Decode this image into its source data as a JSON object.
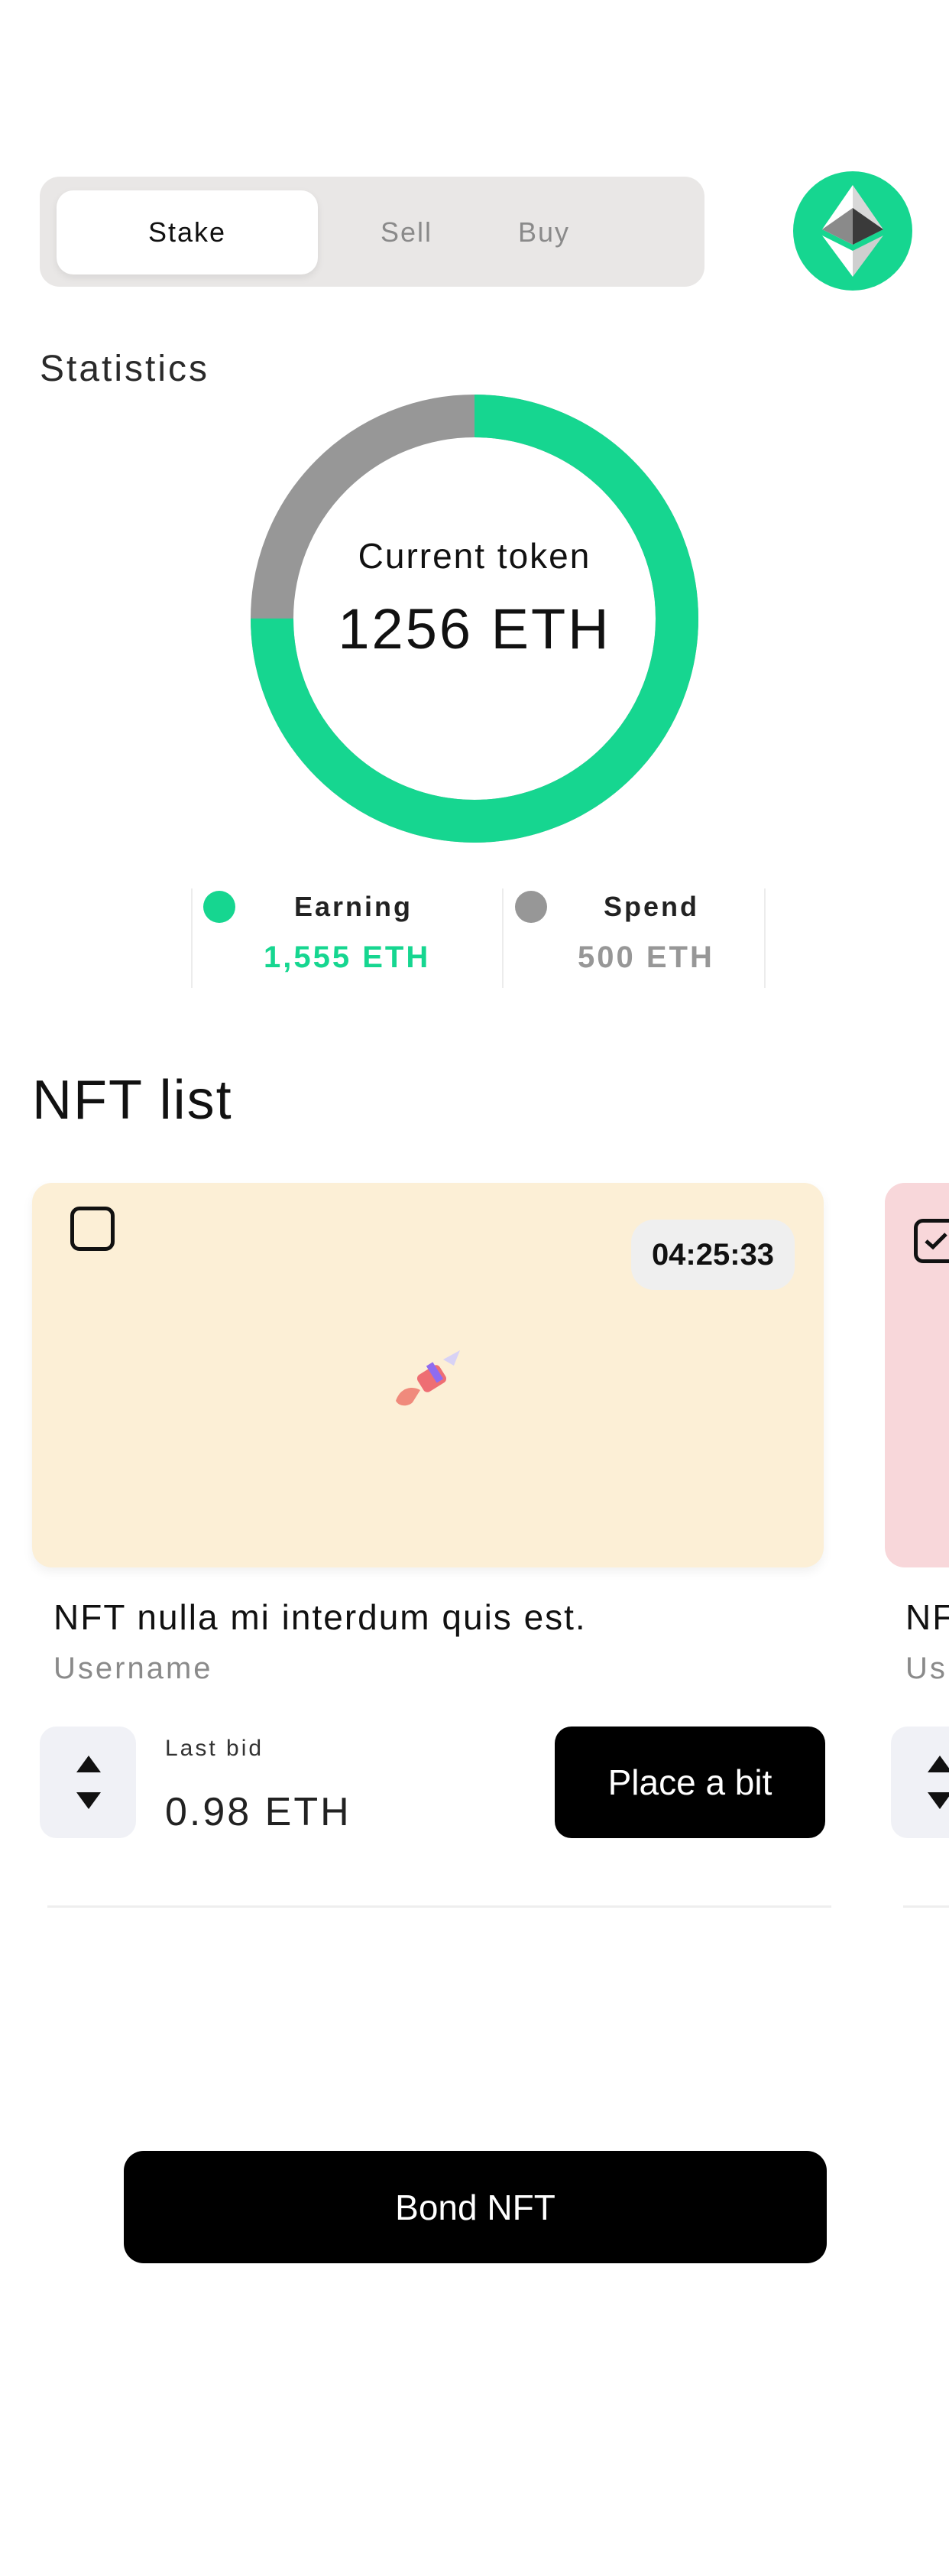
{
  "tabs": [
    {
      "label": "Stake",
      "active": true
    },
    {
      "label": "Sell",
      "active": false
    },
    {
      "label": "Buy",
      "active": false
    }
  ],
  "avatar_icon": "ethereum-icon",
  "statistics": {
    "title": "Statistics",
    "center_label": "Current token",
    "center_value": "1256 ETH",
    "earning_fraction": 0.75,
    "spend_fraction": 0.25,
    "legend": [
      {
        "label": "Earning",
        "value": "1,555 ETH",
        "color": "#16d690"
      },
      {
        "label": "Spend",
        "value": "500 ETH",
        "color": "#979797"
      }
    ]
  },
  "nft_list": {
    "title": "NFT list",
    "cards": [
      {
        "checked": false,
        "timer": "04:25:33",
        "title": "NFT nulla mi interdum quis est.",
        "username": "Username",
        "last_bid_label": "Last bid",
        "last_bid_value": "0.98 ETH",
        "bid_button": "Place a bit",
        "image_bg": "#fcefd6"
      },
      {
        "checked": true,
        "title": "NF",
        "username": "Us",
        "image_bg": "#f8d7da"
      }
    ]
  },
  "bond_button": "Bond NFT",
  "colors": {
    "accent": "#16d690",
    "muted": "#979797",
    "button": "#000000"
  }
}
